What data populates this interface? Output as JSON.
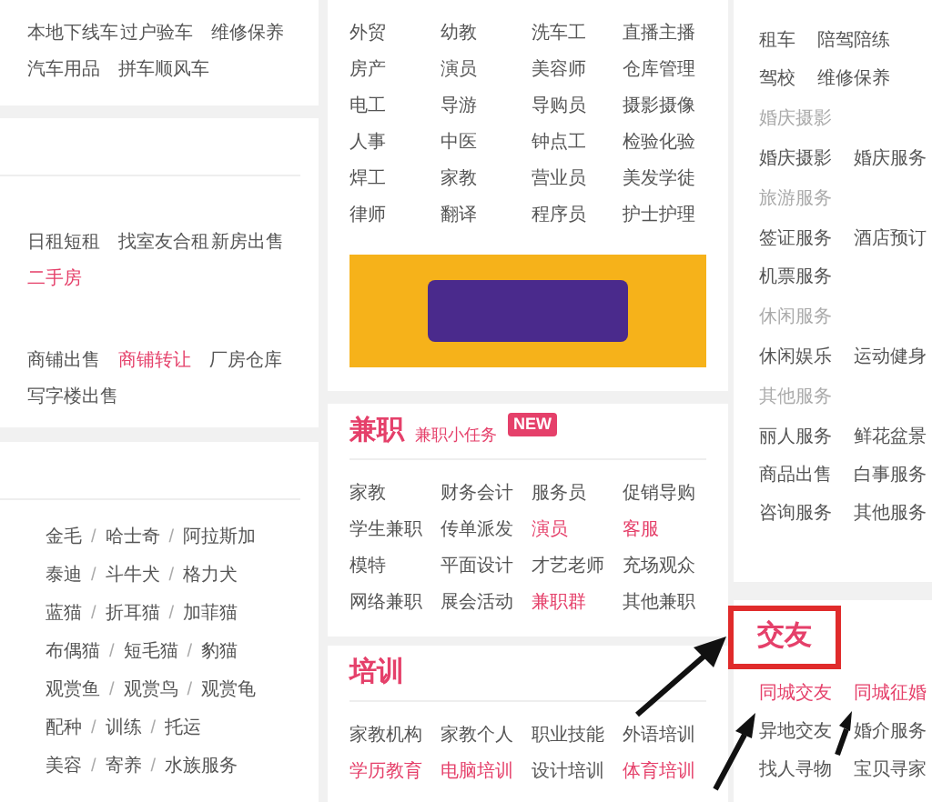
{
  "left_cards": [
    {
      "kind": "rows",
      "groups": [
        [
          [
            {
              "label": "本地下线车",
              "hot": false
            },
            {
              "label": "过户验车",
              "hot": false
            },
            {
              "label": "维修保养",
              "hot": false
            }
          ],
          [
            {
              "label": "汽车用品",
              "hot": false
            },
            {
              "label": "拼车顺风车",
              "hot": false
            }
          ]
        ]
      ]
    },
    {
      "kind": "rows",
      "groups": [
        [
          [
            {
              "label": "日租短租",
              "hot": false
            },
            {
              "label": "找室友合租",
              "hot": false
            },
            {
              "label": "新房出售",
              "hot": false
            }
          ],
          [
            {
              "label": "二手房",
              "hot": true
            }
          ]
        ],
        [
          [
            {
              "label": "商铺出售",
              "hot": false
            },
            {
              "label": "商铺转让",
              "hot": true
            },
            {
              "label": "厂房仓库",
              "hot": false
            }
          ],
          [
            {
              "label": "写字楼出售",
              "hot": false
            }
          ]
        ]
      ]
    },
    {
      "kind": "pets",
      "lines": [
        [
          "金毛",
          "/",
          "哈士奇",
          "/",
          "阿拉斯加"
        ],
        [
          "泰迪",
          "/",
          "斗牛犬",
          "/",
          "格力犬"
        ],
        [
          "蓝猫",
          "/",
          "折耳猫",
          "/",
          "加菲猫"
        ],
        [
          "布偶猫",
          "/",
          "短毛猫",
          "/",
          "豹猫"
        ],
        [
          "观赏鱼",
          "/",
          "观赏鸟",
          "/",
          "观赏龟"
        ],
        [
          "配种",
          "/",
          "训练",
          "/",
          "托运"
        ],
        [
          "美容",
          "/",
          "寄养",
          "/",
          "水族服务"
        ]
      ]
    }
  ],
  "middle_cards": [
    {
      "items": [
        {
          "label": "外贸",
          "hot": false
        },
        {
          "label": "幼教",
          "hot": false
        },
        {
          "label": "洗车工",
          "hot": false
        },
        {
          "label": "直播主播",
          "hot": false
        },
        {
          "label": "房产",
          "hot": false
        },
        {
          "label": "演员",
          "hot": false
        },
        {
          "label": "美容师",
          "hot": false
        },
        {
          "label": "仓库管理",
          "hot": false
        },
        {
          "label": "电工",
          "hot": false
        },
        {
          "label": "导游",
          "hot": false
        },
        {
          "label": "导购员",
          "hot": false
        },
        {
          "label": "摄影摄像",
          "hot": false
        },
        {
          "label": "人事",
          "hot": false
        },
        {
          "label": "中医",
          "hot": false
        },
        {
          "label": "钟点工",
          "hot": false
        },
        {
          "label": "检验化验",
          "hot": false
        },
        {
          "label": "焊工",
          "hot": false
        },
        {
          "label": "家教",
          "hot": false
        },
        {
          "label": "营业员",
          "hot": false
        },
        {
          "label": "美发学徒",
          "hot": false
        },
        {
          "label": "律师",
          "hot": false
        },
        {
          "label": "翻译",
          "hot": false
        },
        {
          "label": "程序员",
          "hot": false
        },
        {
          "label": "护士护理",
          "hot": false
        }
      ],
      "banner": true
    },
    {
      "title": "兼职",
      "subtitle": "兼职小任务",
      "badge": "NEW",
      "items": [
        {
          "label": "家教",
          "hot": false
        },
        {
          "label": "财务会计",
          "hot": false
        },
        {
          "label": "服务员",
          "hot": false
        },
        {
          "label": "促销导购",
          "hot": false
        },
        {
          "label": "学生兼职",
          "hot": false
        },
        {
          "label": "传单派发",
          "hot": false
        },
        {
          "label": "演员",
          "hot": true
        },
        {
          "label": "客服",
          "hot": true
        },
        {
          "label": "模特",
          "hot": false
        },
        {
          "label": "平面设计",
          "hot": false
        },
        {
          "label": "才艺老师",
          "hot": false
        },
        {
          "label": "充场观众",
          "hot": false
        },
        {
          "label": "网络兼职",
          "hot": false
        },
        {
          "label": "展会活动",
          "hot": false
        },
        {
          "label": "兼职群",
          "hot": true
        },
        {
          "label": "其他兼职",
          "hot": false
        }
      ]
    },
    {
      "title": "培训",
      "items": [
        {
          "label": "家教机构",
          "hot": false
        },
        {
          "label": "家教个人",
          "hot": false
        },
        {
          "label": "职业技能",
          "hot": false
        },
        {
          "label": "外语培训",
          "hot": false
        },
        {
          "label": "学历教育",
          "hot": true
        },
        {
          "label": "电脑培训",
          "hot": true
        },
        {
          "label": "设计培训",
          "hot": false
        },
        {
          "label": "体育培训",
          "hot": true
        }
      ]
    }
  ],
  "right_cards": [
    {
      "entries": [
        {
          "kind": "row",
          "items": [
            {
              "label": "租车",
              "hot": false
            },
            {
              "label": "陪驾陪练",
              "hot": false
            }
          ]
        },
        {
          "kind": "row",
          "items": [
            {
              "label": "驾校",
              "hot": false
            },
            {
              "label": "维修保养",
              "hot": false
            }
          ]
        },
        {
          "kind": "label",
          "text": "婚庆摄影"
        },
        {
          "kind": "row",
          "items": [
            {
              "label": "婚庆摄影",
              "hot": false
            },
            {
              "label": "婚庆服务",
              "hot": false
            }
          ]
        },
        {
          "kind": "label",
          "text": "旅游服务"
        },
        {
          "kind": "row",
          "items": [
            {
              "label": "签证服务",
              "hot": false
            },
            {
              "label": "酒店预订",
              "hot": false
            }
          ]
        },
        {
          "kind": "row",
          "items": [
            {
              "label": "机票服务",
              "hot": false
            }
          ]
        },
        {
          "kind": "label",
          "text": "休闲服务"
        },
        {
          "kind": "row",
          "items": [
            {
              "label": "休闲娱乐",
              "hot": false
            },
            {
              "label": "运动健身",
              "hot": false
            }
          ]
        },
        {
          "kind": "label",
          "text": "其他服务"
        },
        {
          "kind": "row",
          "items": [
            {
              "label": "丽人服务",
              "hot": false
            },
            {
              "label": "鲜花盆景",
              "hot": false
            }
          ]
        },
        {
          "kind": "row",
          "items": [
            {
              "label": "商品出售",
              "hot": false
            },
            {
              "label": "白事服务",
              "hot": false
            }
          ]
        },
        {
          "kind": "row",
          "items": [
            {
              "label": "咨询服务",
              "hot": false
            },
            {
              "label": "其他服务",
              "hot": false
            }
          ]
        }
      ]
    },
    {
      "title": "交友",
      "highlighted": true,
      "entries": [
        {
          "kind": "row",
          "items": [
            {
              "label": "同城交友",
              "hot": true
            },
            {
              "label": "同城征婚",
              "hot": true
            }
          ]
        },
        {
          "kind": "row",
          "items": [
            {
              "label": "异地交友",
              "hot": false
            },
            {
              "label": "婚介服务",
              "hot": false
            }
          ]
        },
        {
          "kind": "row",
          "items": [
            {
              "label": "找人寻物",
              "hot": false
            },
            {
              "label": "宝贝寻家",
              "hot": false
            }
          ]
        }
      ]
    }
  ]
}
